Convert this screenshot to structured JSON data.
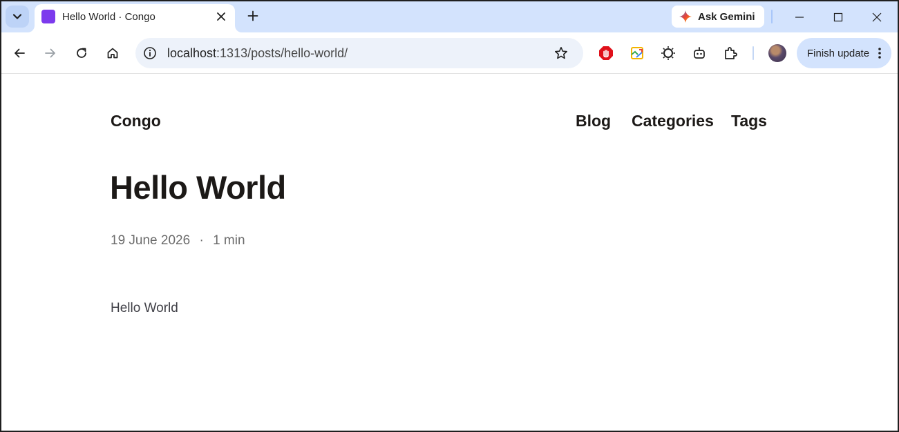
{
  "browser": {
    "tab": {
      "title": "Hello World · Congo",
      "favicon_color": "#7c3aed"
    },
    "gemini_label": "Ask Gemini",
    "address": {
      "host": "localhost",
      "rest": ":1313/posts/hello-world/"
    },
    "finish_update_label": "Finish update",
    "icons": [
      "tab-search-icon",
      "close-icon",
      "plus-icon",
      "gemini-icon",
      "minimize-icon",
      "maximize-icon",
      "window-close-icon",
      "back-icon",
      "forward-icon",
      "reload-icon",
      "home-icon",
      "site-info-icon",
      "bookmark-star-icon",
      "adblock-extension-icon",
      "image-extension-icon",
      "sun-extension-icon",
      "robot-extension-icon",
      "extensions-puzzle-icon",
      "profile-avatar",
      "more-menu-icon"
    ]
  },
  "site": {
    "title": "Congo",
    "nav": [
      {
        "label": "Blog"
      },
      {
        "label": "Categories"
      },
      {
        "label": "Tags"
      }
    ]
  },
  "post": {
    "title": "Hello World",
    "date": "19 June 2026",
    "separator": "·",
    "reading_time": "1 min",
    "body": "Hello World"
  },
  "colors": {
    "tabstrip": "#d3e3fd",
    "omnibox": "#edf2fa",
    "text_dark": "#1c1917",
    "meta_text": "#6b6b6b"
  }
}
